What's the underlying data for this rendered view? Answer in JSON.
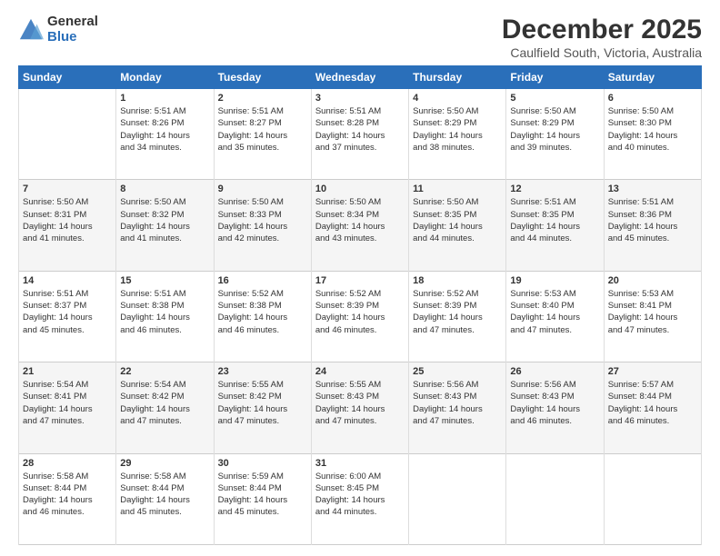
{
  "logo": {
    "general": "General",
    "blue": "Blue"
  },
  "header": {
    "title": "December 2025",
    "subtitle": "Caulfield South, Victoria, Australia"
  },
  "weekdays": [
    "Sunday",
    "Monday",
    "Tuesday",
    "Wednesday",
    "Thursday",
    "Friday",
    "Saturday"
  ],
  "weeks": [
    [
      {
        "day": "",
        "sunrise": "",
        "sunset": "",
        "daylight": ""
      },
      {
        "day": "1",
        "sunrise": "Sunrise: 5:51 AM",
        "sunset": "Sunset: 8:26 PM",
        "daylight": "Daylight: 14 hours and 34 minutes."
      },
      {
        "day": "2",
        "sunrise": "Sunrise: 5:51 AM",
        "sunset": "Sunset: 8:27 PM",
        "daylight": "Daylight: 14 hours and 35 minutes."
      },
      {
        "day": "3",
        "sunrise": "Sunrise: 5:51 AM",
        "sunset": "Sunset: 8:28 PM",
        "daylight": "Daylight: 14 hours and 37 minutes."
      },
      {
        "day": "4",
        "sunrise": "Sunrise: 5:50 AM",
        "sunset": "Sunset: 8:29 PM",
        "daylight": "Daylight: 14 hours and 38 minutes."
      },
      {
        "day": "5",
        "sunrise": "Sunrise: 5:50 AM",
        "sunset": "Sunset: 8:29 PM",
        "daylight": "Daylight: 14 hours and 39 minutes."
      },
      {
        "day": "6",
        "sunrise": "Sunrise: 5:50 AM",
        "sunset": "Sunset: 8:30 PM",
        "daylight": "Daylight: 14 hours and 40 minutes."
      }
    ],
    [
      {
        "day": "7",
        "sunrise": "Sunrise: 5:50 AM",
        "sunset": "Sunset: 8:31 PM",
        "daylight": "Daylight: 14 hours and 41 minutes."
      },
      {
        "day": "8",
        "sunrise": "Sunrise: 5:50 AM",
        "sunset": "Sunset: 8:32 PM",
        "daylight": "Daylight: 14 hours and 41 minutes."
      },
      {
        "day": "9",
        "sunrise": "Sunrise: 5:50 AM",
        "sunset": "Sunset: 8:33 PM",
        "daylight": "Daylight: 14 hours and 42 minutes."
      },
      {
        "day": "10",
        "sunrise": "Sunrise: 5:50 AM",
        "sunset": "Sunset: 8:34 PM",
        "daylight": "Daylight: 14 hours and 43 minutes."
      },
      {
        "day": "11",
        "sunrise": "Sunrise: 5:50 AM",
        "sunset": "Sunset: 8:35 PM",
        "daylight": "Daylight: 14 hours and 44 minutes."
      },
      {
        "day": "12",
        "sunrise": "Sunrise: 5:51 AM",
        "sunset": "Sunset: 8:35 PM",
        "daylight": "Daylight: 14 hours and 44 minutes."
      },
      {
        "day": "13",
        "sunrise": "Sunrise: 5:51 AM",
        "sunset": "Sunset: 8:36 PM",
        "daylight": "Daylight: 14 hours and 45 minutes."
      }
    ],
    [
      {
        "day": "14",
        "sunrise": "Sunrise: 5:51 AM",
        "sunset": "Sunset: 8:37 PM",
        "daylight": "Daylight: 14 hours and 45 minutes."
      },
      {
        "day": "15",
        "sunrise": "Sunrise: 5:51 AM",
        "sunset": "Sunset: 8:38 PM",
        "daylight": "Daylight: 14 hours and 46 minutes."
      },
      {
        "day": "16",
        "sunrise": "Sunrise: 5:52 AM",
        "sunset": "Sunset: 8:38 PM",
        "daylight": "Daylight: 14 hours and 46 minutes."
      },
      {
        "day": "17",
        "sunrise": "Sunrise: 5:52 AM",
        "sunset": "Sunset: 8:39 PM",
        "daylight": "Daylight: 14 hours and 46 minutes."
      },
      {
        "day": "18",
        "sunrise": "Sunrise: 5:52 AM",
        "sunset": "Sunset: 8:39 PM",
        "daylight": "Daylight: 14 hours and 47 minutes."
      },
      {
        "day": "19",
        "sunrise": "Sunrise: 5:53 AM",
        "sunset": "Sunset: 8:40 PM",
        "daylight": "Daylight: 14 hours and 47 minutes."
      },
      {
        "day": "20",
        "sunrise": "Sunrise: 5:53 AM",
        "sunset": "Sunset: 8:41 PM",
        "daylight": "Daylight: 14 hours and 47 minutes."
      }
    ],
    [
      {
        "day": "21",
        "sunrise": "Sunrise: 5:54 AM",
        "sunset": "Sunset: 8:41 PM",
        "daylight": "Daylight: 14 hours and 47 minutes."
      },
      {
        "day": "22",
        "sunrise": "Sunrise: 5:54 AM",
        "sunset": "Sunset: 8:42 PM",
        "daylight": "Daylight: 14 hours and 47 minutes."
      },
      {
        "day": "23",
        "sunrise": "Sunrise: 5:55 AM",
        "sunset": "Sunset: 8:42 PM",
        "daylight": "Daylight: 14 hours and 47 minutes."
      },
      {
        "day": "24",
        "sunrise": "Sunrise: 5:55 AM",
        "sunset": "Sunset: 8:43 PM",
        "daylight": "Daylight: 14 hours and 47 minutes."
      },
      {
        "day": "25",
        "sunrise": "Sunrise: 5:56 AM",
        "sunset": "Sunset: 8:43 PM",
        "daylight": "Daylight: 14 hours and 47 minutes."
      },
      {
        "day": "26",
        "sunrise": "Sunrise: 5:56 AM",
        "sunset": "Sunset: 8:43 PM",
        "daylight": "Daylight: 14 hours and 46 minutes."
      },
      {
        "day": "27",
        "sunrise": "Sunrise: 5:57 AM",
        "sunset": "Sunset: 8:44 PM",
        "daylight": "Daylight: 14 hours and 46 minutes."
      }
    ],
    [
      {
        "day": "28",
        "sunrise": "Sunrise: 5:58 AM",
        "sunset": "Sunset: 8:44 PM",
        "daylight": "Daylight: 14 hours and 46 minutes."
      },
      {
        "day": "29",
        "sunrise": "Sunrise: 5:58 AM",
        "sunset": "Sunset: 8:44 PM",
        "daylight": "Daylight: 14 hours and 45 minutes."
      },
      {
        "day": "30",
        "sunrise": "Sunrise: 5:59 AM",
        "sunset": "Sunset: 8:44 PM",
        "daylight": "Daylight: 14 hours and 45 minutes."
      },
      {
        "day": "31",
        "sunrise": "Sunrise: 6:00 AM",
        "sunset": "Sunset: 8:45 PM",
        "daylight": "Daylight: 14 hours and 44 minutes."
      },
      {
        "day": "",
        "sunrise": "",
        "sunset": "",
        "daylight": ""
      },
      {
        "day": "",
        "sunrise": "",
        "sunset": "",
        "daylight": ""
      },
      {
        "day": "",
        "sunrise": "",
        "sunset": "",
        "daylight": ""
      }
    ]
  ]
}
